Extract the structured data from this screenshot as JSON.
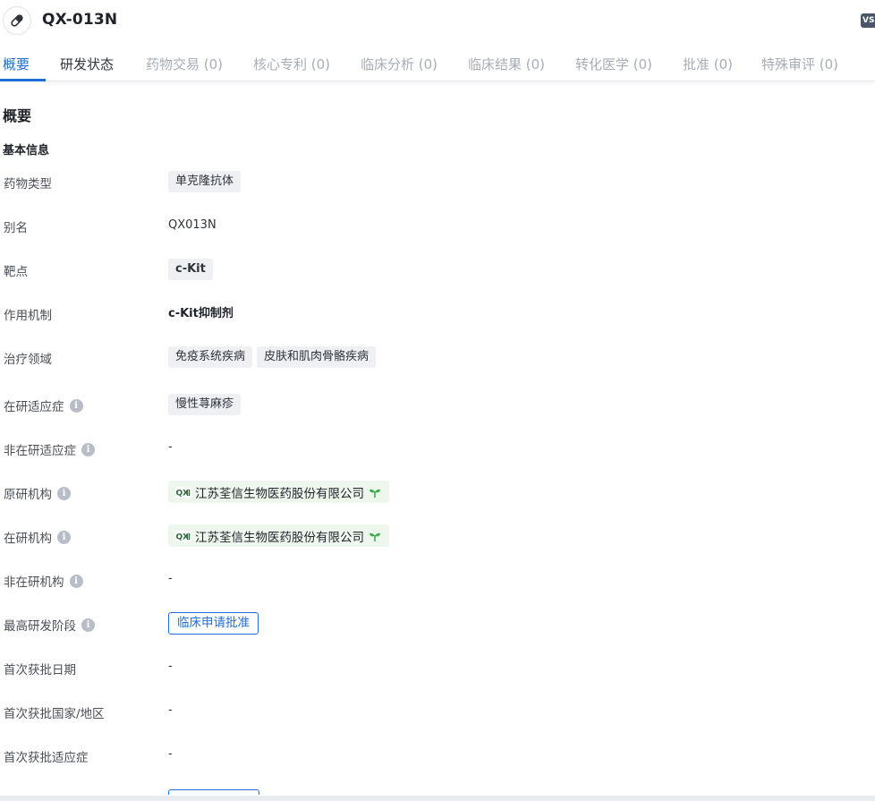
{
  "header": {
    "title": "QX-013N",
    "corner_badge": "VS",
    "icon": "capsule-icon"
  },
  "tabs": [
    {
      "label": "概要",
      "state": "active"
    },
    {
      "label": "研发状态",
      "state": "normal"
    },
    {
      "label": "药物交易 (0)",
      "state": "disabled"
    },
    {
      "label": "核心专利 (0)",
      "state": "disabled"
    },
    {
      "label": "临床分析 (0)",
      "state": "disabled"
    },
    {
      "label": "临床结果 (0)",
      "state": "disabled"
    },
    {
      "label": "转化医学 (0)",
      "state": "disabled"
    },
    {
      "label": "批准 (0)",
      "state": "disabled"
    },
    {
      "label": "特殊审评 (0)",
      "state": "disabled"
    }
  ],
  "overview": {
    "section_title": "概要",
    "basic_info_title": "基本信息",
    "fields": {
      "drug_type": {
        "label": "药物类型",
        "chips": [
          "单克隆抗体"
        ]
      },
      "alias": {
        "label": "别名",
        "value": "QX013N"
      },
      "target": {
        "label": "靶点",
        "chips": [
          "c-Kit"
        ]
      },
      "mechanism": {
        "label": "作用机制",
        "value": "c-Kit抑制剂"
      },
      "therapeutic_area": {
        "label": "治疗领域",
        "chips": [
          "免疫系统疾病",
          "皮肤和肌肉骨骼疾病"
        ]
      },
      "active_indication": {
        "label": "在研适应症",
        "chips": [
          "慢性荨麻疹"
        ]
      },
      "inactive_indication": {
        "label": "非在研适应症",
        "value": "-"
      },
      "originator": {
        "label": "原研机构",
        "org": "江苏荃信生物医药股份有限公司"
      },
      "active_org": {
        "label": "在研机构",
        "org": "江苏荃信生物医药股份有限公司"
      },
      "inactive_org": {
        "label": "非在研机构",
        "value": "-"
      },
      "highest_phase": {
        "label": "最高研发阶段",
        "phase": "临床申请批准"
      },
      "first_approval_date": {
        "label": "首次获批日期",
        "value": "-"
      },
      "first_approval_region": {
        "label": "首次获批国家/地区",
        "value": "-"
      },
      "first_approval_indication": {
        "label": "首次获批适应症",
        "value": "-"
      }
    }
  },
  "colors": {
    "accent": "#1f6fd6",
    "chip_bg": "#eef0f3",
    "org_chip_bg": "#edf7ee",
    "sprout": "#3dae4a"
  }
}
